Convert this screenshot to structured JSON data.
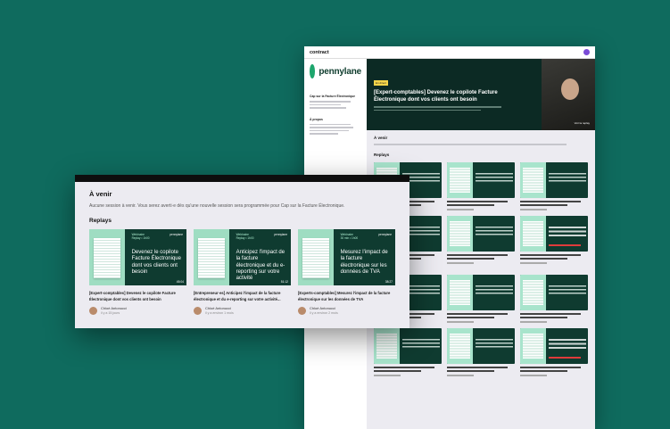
{
  "back_page": {
    "brand": "contract",
    "logo_word": "pennylane",
    "sidebar": {
      "section_title": "Cap sur la Facture Électronique",
      "about_title": "À propos"
    },
    "hero": {
      "badge": "En direct",
      "title": "[Expert-comptables] Devenez le copilote Facture Électronique dont vos clients ont besoin",
      "watch_label": "Voir la replay"
    },
    "upcoming_title": "À venir",
    "replays_title": "Replays"
  },
  "front": {
    "upcoming_title": "À venir",
    "upcoming_text": "Aucune session à venir. Vous serez averti·e dès qu'une nouvelle session sera programmée pour Cap sur la Facture Électronique.",
    "replays_title": "Replays",
    "cards": [
      {
        "tag": "Webinaire\nReplay • 1h00",
        "logo": "pennylane",
        "title": "Devenez le copilote Facture Électronique dont vos clients ont besoin",
        "duration": "45:04",
        "caption": "[Expert-comptables] Devenez le copilote Facture Électronique dont vos clients ont besoin",
        "author": "Chloé Antonucci",
        "date": "il y a 15 jours"
      },
      {
        "tag": "Webinaire\nReplay • 1h00",
        "logo": "pennylane",
        "title": "Anticipez l'impact de la facture électronique et du e-reporting sur votre activité",
        "duration": "51:12",
        "caption": "[Entrepreneur·es] Anticipez l'impact de la facture électronique et du e-reporting sur votre activité...",
        "author": "Chloé Antonucci",
        "date": "il y a environ 1 mois"
      },
      {
        "tag": "Webinaire\n30 min • 1h00",
        "logo": "pennylane",
        "title": "Mesurez l'impact de la facture électronique sur les données de TVA",
        "duration": "38:27",
        "caption": "[Experts-comptables] Mesurez l'impact de la facture électronique sur les données de TVA",
        "author": "Chloé Antonucci",
        "date": "il y a environ 2 mois"
      }
    ]
  },
  "colors": {
    "background": "#0f6b5e",
    "thumb_dark": "#0f3b30",
    "thumb_mint": "#9fddc2",
    "accent_green": "#1ea66d"
  }
}
